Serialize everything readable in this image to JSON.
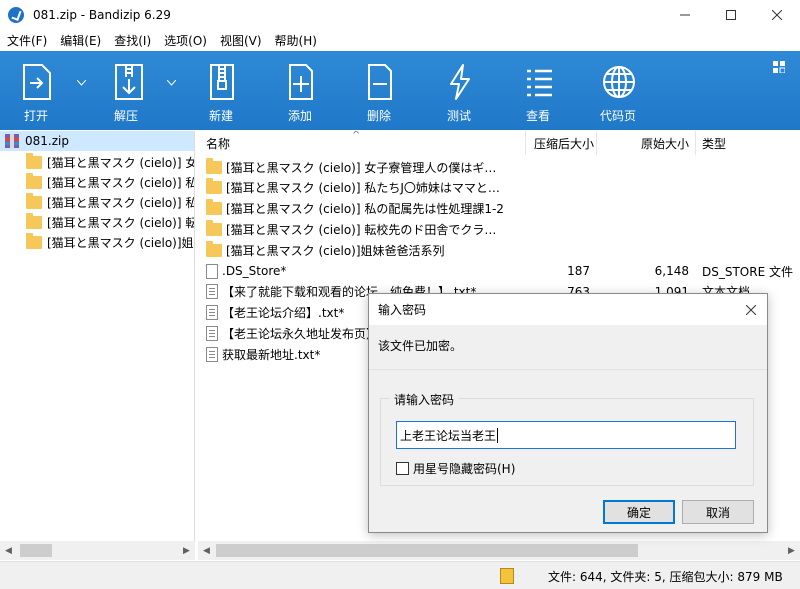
{
  "window": {
    "title": "081.zip - Bandizip 6.29",
    "controls": {
      "minimize": "—",
      "maximize": "☐",
      "close": "✕"
    }
  },
  "menubar": [
    "文件(F)",
    "编辑(E)",
    "查找(I)",
    "选项(O)",
    "视图(V)",
    "帮助(H)"
  ],
  "toolbar": {
    "open": "打开",
    "extract": "解压",
    "new": "新建",
    "add": "添加",
    "delete": "删除",
    "test": "测试",
    "view": "查看",
    "codepage": "代码页"
  },
  "tree": {
    "root": "081.zip",
    "items": [
      "[猫耳と黒マスク (cielo)] 女子",
      "[猫耳と黒マスク (cielo)] 私た",
      "[猫耳と黒マスク (cielo)] 私の",
      "[猫耳と黒マスク (cielo)] 転校",
      "[猫耳と黒マスク (cielo)]姐妹"
    ]
  },
  "list": {
    "headers": {
      "name": "名称",
      "packed": "压缩后大小",
      "original": "原始大小",
      "type": "类型"
    },
    "rows": [
      {
        "name": "[猫耳と黒マスク (cielo)] 女子寮管理人の僕はギ…",
        "packed": "",
        "original": "",
        "type": "",
        "kind": "folder"
      },
      {
        "name": "[猫耳と黒マスク (cielo)] 私たちJ〇姉妹はママと…",
        "packed": "",
        "original": "",
        "type": "",
        "kind": "folder"
      },
      {
        "name": "[猫耳と黒マスク (cielo)] 私の配属先は性処理課1-2",
        "packed": "",
        "original": "",
        "type": "",
        "kind": "folder"
      },
      {
        "name": "[猫耳と黒マスク (cielo)] 転校先のド田舎でクラ…",
        "packed": "",
        "original": "",
        "type": "",
        "kind": "folder"
      },
      {
        "name": "[猫耳と黒マスク (cielo)]姐妹爸爸活系列",
        "packed": "",
        "original": "",
        "type": "",
        "kind": "folder"
      },
      {
        "name": ".DS_Store*",
        "packed": "187",
        "original": "6,148",
        "type": "DS_STORE 文件",
        "kind": "file"
      },
      {
        "name": "【来了就能下载和观看的论坛，纯免费！】.txt*",
        "packed": "763",
        "original": "1,091",
        "type": "文本文档",
        "kind": "txt"
      },
      {
        "name": "【老王论坛介绍】.txt*",
        "packed": "",
        "original": "",
        "type": "",
        "kind": "txt"
      },
      {
        "name": "【老王论坛永久地址发布页】",
        "packed": "",
        "original": "",
        "type": "",
        "kind": "txt"
      },
      {
        "name": "获取最新地址.txt*",
        "packed": "",
        "original": "",
        "type": "",
        "kind": "txt"
      }
    ]
  },
  "status": {
    "text": "文件: 644, 文件夹: 5, 压缩包大小: 879 MB"
  },
  "dialog": {
    "title": "输入密码",
    "message": "该文件已加密。",
    "group_label": "请输入密码",
    "password_value": "上老王论坛当老王",
    "checkbox_label": "用星号隐藏密码(H)",
    "checkbox_checked": false,
    "ok": "确定",
    "cancel": "取消"
  },
  "colors": {
    "toolbar": "#2f8ad6",
    "selection": "#cde8ff",
    "accent": "#0078d7"
  }
}
